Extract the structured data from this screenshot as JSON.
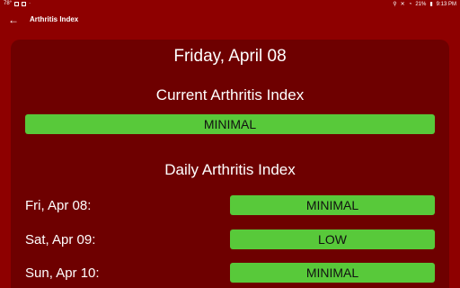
{
  "status_bar": {
    "left_text": "78°",
    "battery": "21%",
    "time": "9:13 PM"
  },
  "app_bar": {
    "title": "Arthritis Index"
  },
  "main": {
    "date": "Friday, April 08",
    "current_heading": "Current Arthritis Index",
    "current_level": "MINIMAL",
    "daily_heading": "Daily Arthritis Index",
    "days": [
      {
        "label": "Fri, Apr 08:",
        "level": "MINIMAL"
      },
      {
        "label": "Sat, Apr 09:",
        "level": "LOW"
      },
      {
        "label": "Sun, Apr 10:",
        "level": "MINIMAL"
      }
    ]
  },
  "colors": {
    "background": "#8e0000",
    "card": "#6e0000",
    "level_bar": "#58c93a"
  }
}
